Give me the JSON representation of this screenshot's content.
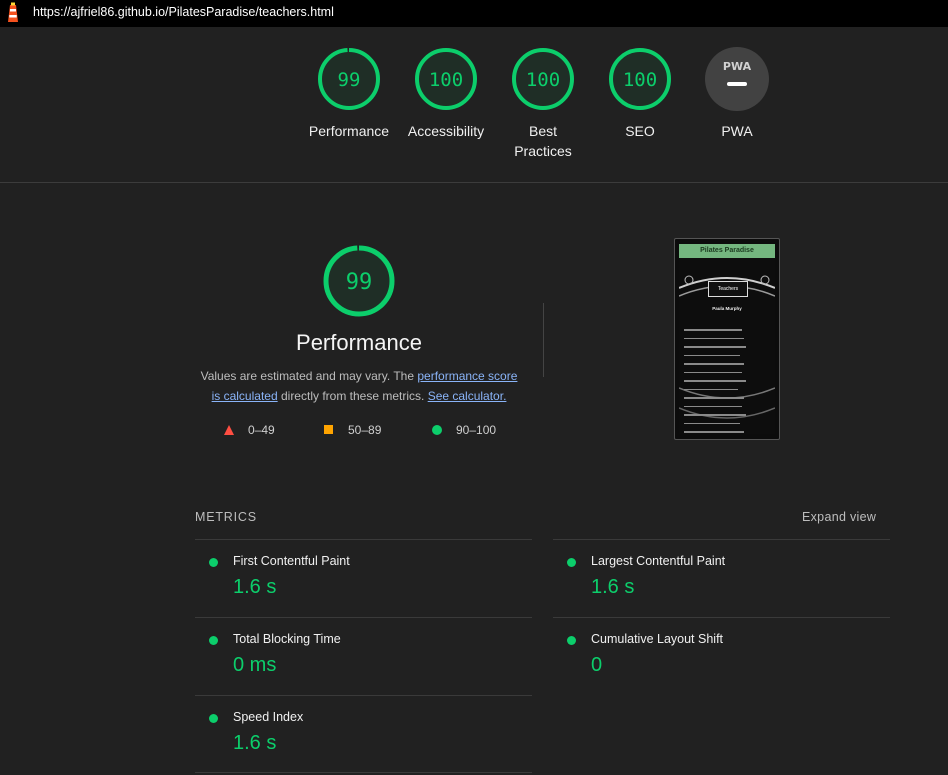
{
  "browser": {
    "url": "https://ajfriel86.github.io/PilatesParadise/teachers.html"
  },
  "categories": [
    {
      "label": "Performance",
      "score": "99",
      "fraction": 0.99
    },
    {
      "label": "Accessibility",
      "score": "100",
      "fraction": 1.0
    },
    {
      "label": "Best Practices",
      "score": "100",
      "fraction": 1.0
    },
    {
      "label": "SEO",
      "score": "100",
      "fraction": 1.0
    },
    {
      "label": "PWA",
      "score": "",
      "fraction": 0
    }
  ],
  "pwa_badge": "PWA",
  "performance": {
    "score": "99",
    "fraction": 0.99,
    "title": "Performance",
    "desc_pre": "Values are estimated and may vary. The ",
    "desc_link1": "performance score is calculated",
    "desc_mid": " directly from these metrics. ",
    "desc_link2": "See calculator."
  },
  "legend": {
    "fail": "0–49",
    "average": "50–89",
    "pass": "90–100"
  },
  "colors": {
    "pass": "#0cce6b",
    "average": "#ffa400",
    "fail": "#ff4e42",
    "link": "#8ab4f8"
  },
  "thumbnail": {
    "site_title": "Pilates Paradise",
    "hero_title": "Teachers",
    "name": "Paula Murphy"
  },
  "metrics": {
    "header": "METRICS",
    "expand": "Expand view",
    "items": [
      {
        "name": "First Contentful Paint",
        "value": "1.6 s"
      },
      {
        "name": "Largest Contentful Paint",
        "value": "1.6 s"
      },
      {
        "name": "Total Blocking Time",
        "value": "0 ms"
      },
      {
        "name": "Cumulative Layout Shift",
        "value": "0"
      },
      {
        "name": "Speed Index",
        "value": "1.6 s"
      }
    ]
  }
}
